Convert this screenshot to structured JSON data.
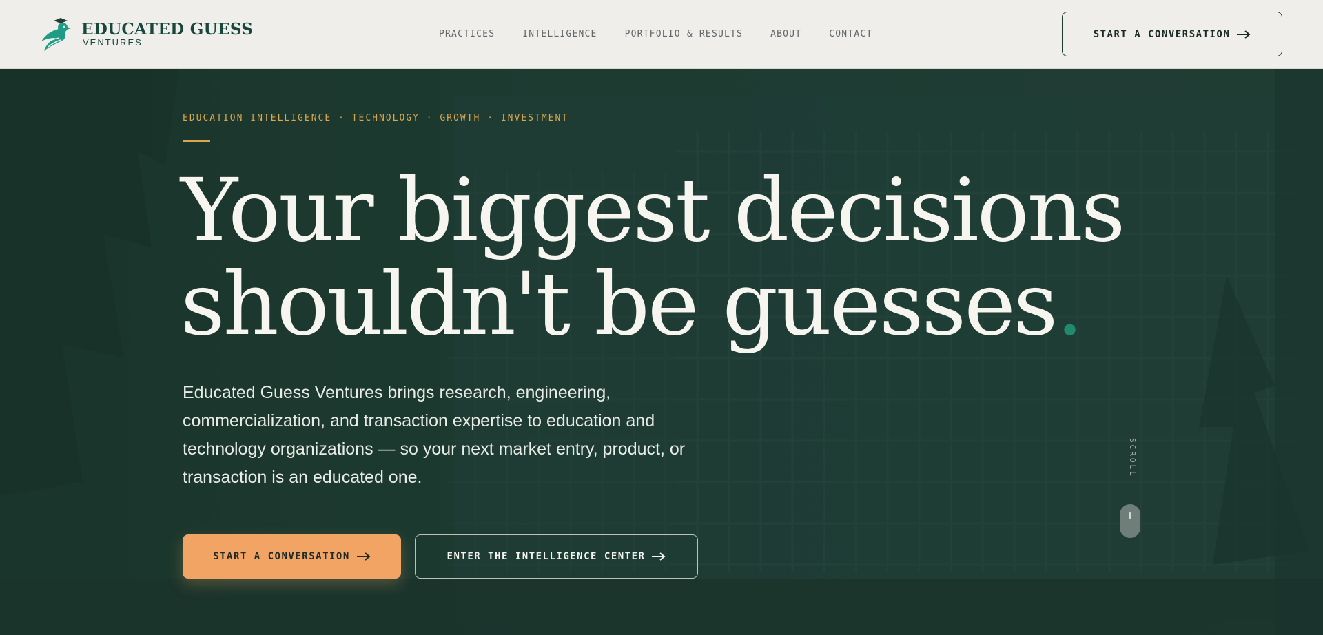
{
  "brand": {
    "name": "EDUCATED GUESS",
    "sub": "VENTURES",
    "logo_icon": "bird-logo-icon"
  },
  "nav": {
    "items": [
      {
        "label": "PRACTICES"
      },
      {
        "label": "INTELLIGENCE"
      },
      {
        "label": "PORTFOLIO & RESULTS"
      },
      {
        "label": "ABOUT"
      },
      {
        "label": "CONTACT"
      }
    ],
    "cta_label": "START A CONVERSATION",
    "cta_icon": "arrow-right-icon"
  },
  "hero": {
    "eyebrow": "EDUCATION INTELLIGENCE · TECHNOLOGY · GROWTH · INVESTMENT",
    "headline_line1": "Your biggest decisions",
    "headline_line2": "shouldn't be guesses",
    "headline_dot": ".",
    "lede": "Educated Guess Ventures brings research, engineering, commercialization, and transaction expertise to education and technology organizations — so your next market entry, product, or transaction is an educated one.",
    "primary_cta": "START A CONVERSATION",
    "secondary_cta": "ENTER THE INTELLIGENCE CENTER",
    "scroll_label": "SCROLL"
  },
  "colors": {
    "header_bg": "#efeeea",
    "hero_bg": "#1c3a31",
    "brand_green": "#17473d",
    "accent_gold": "#d9a74c",
    "accent_orange": "#f1a463",
    "dot_teal": "#1f8a70",
    "hero_text": "#f7f5ef"
  }
}
